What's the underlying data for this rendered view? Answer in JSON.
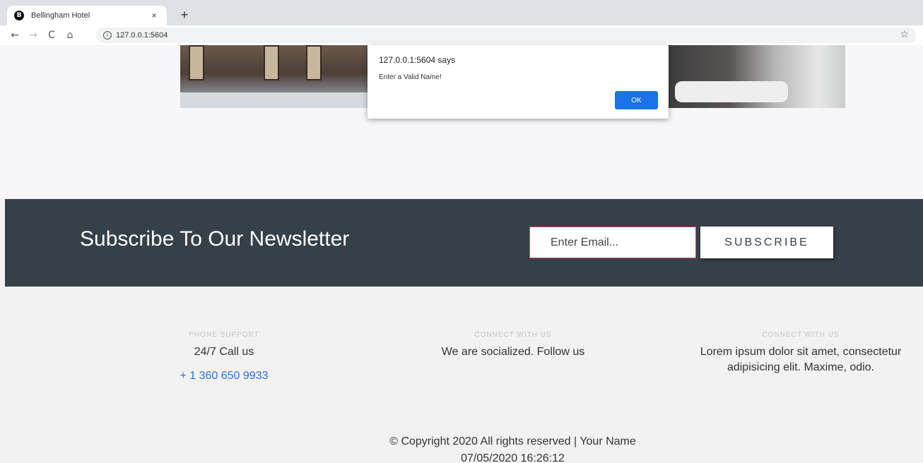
{
  "browser": {
    "tab_favicon": "B",
    "tab_title": "Bellingham Hotel",
    "tab_close": "×",
    "new_tab": "+",
    "nav": {
      "back": "←",
      "forward": "→",
      "reload": "C",
      "home": "⌂"
    },
    "url": "127.0.0.1:5604",
    "info_glyph": "i",
    "bookmark_star": "☆"
  },
  "newsletter": {
    "title": "Subscribe To Our Newsletter",
    "email_placeholder": "Enter Email...",
    "subscribe_label": "SUBSCRIBE"
  },
  "footer": {
    "phone": {
      "label": "PHONE SUPPORT",
      "text": "24/7 Call us",
      "number": "+ 1 360 650 9933"
    },
    "social": {
      "label": "CONNECT WITH US",
      "text": "We are socialized. Follow us"
    },
    "about": {
      "label": "CONNECT WITH US",
      "text": "Lorem ipsum dolor sit amet, consectetur adipisicing elit. Maxime, odio."
    },
    "copyright": "© Copyright 2020 All rights reserved | Your Name",
    "datetime": "07/05/2020 16:26:12"
  },
  "dialog": {
    "title": "127.0.0.1:5604 says",
    "message": "Enter a Valid Name!",
    "ok_label": "OK"
  },
  "colors": {
    "newsletter_bg": "#364048",
    "input_border": "#e2465f",
    "phone_link": "#2c6fe0",
    "ok_button": "#1a73e8"
  }
}
